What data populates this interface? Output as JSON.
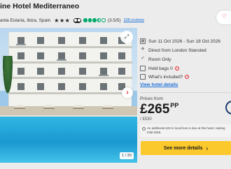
{
  "hotel": {
    "name": "ine Hotel Mediterraneo",
    "location": "anta Eularia, Ibiza, Spain",
    "stars": "★★★",
    "rating": "(3.5/5)",
    "reviews": "338 reviews",
    "rating_value": 3.5,
    "star_count": 3
  },
  "gallery": {
    "counter": "1 / 30"
  },
  "details": {
    "dates": "Sun 11 Oct 2026 - Sun 18 Oct 2026",
    "flight": "Direct from London Stansted",
    "board": "Room Only",
    "hold_bags_label": "Hold bags",
    "hold_bags_value": "0",
    "whats_included": "What's included?",
    "view_link": "View hotel details"
  },
  "pricing": {
    "prices_from": "Prices from",
    "amount": "£265",
    "per": "PP",
    "total": "/ £530",
    "notice": "An additional £20 in local fees is due at this hotel, making total £555."
  },
  "cta": {
    "label": "See more details"
  },
  "colors": {
    "accent_red": "#e4222b",
    "cta_yellow": "#fbc92c",
    "link_blue": "#1a6fd8",
    "tripadvisor_green": "#00aa6c"
  }
}
